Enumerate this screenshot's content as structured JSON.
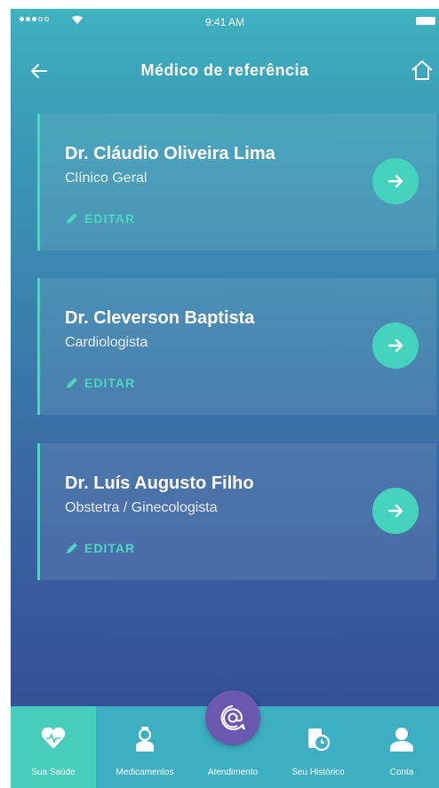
{
  "status_bar": {
    "time": "9:41 AM"
  },
  "nav": {
    "title": "Médico de referência",
    "back_icon": "arrow-left-icon",
    "home_icon": "home-icon"
  },
  "doctors": [
    {
      "name": "Dr. Cláudio Oliveira Lima",
      "specialty": "Clínico Geral",
      "edit_label": "EDITAR"
    },
    {
      "name": "Dr. Cleverson Baptista",
      "specialty": "Cardiologista",
      "edit_label": "EDITAR"
    },
    {
      "name": "Dr. Luís Augusto Filho",
      "specialty": "Obstetra / Ginecologista",
      "edit_label": "EDITAR"
    }
  ],
  "tabs": [
    {
      "label": "Sua Saúde",
      "icon": "heart-icon",
      "active": true
    },
    {
      "label": "Medicamentos",
      "icon": "nurse-icon",
      "active": false
    },
    {
      "label": "Atendimento",
      "icon": "at-chat-icon",
      "active": false
    },
    {
      "label": "Seu Histórico",
      "icon": "history-clock-icon",
      "active": false
    },
    {
      "label": "Conta",
      "icon": "user-icon",
      "active": false
    }
  ],
  "colors": {
    "accent": "#45d3bd",
    "active_tab": "#46cdbb",
    "tab_bar": "#3cb0c2",
    "fab": "#6a58b0"
  }
}
